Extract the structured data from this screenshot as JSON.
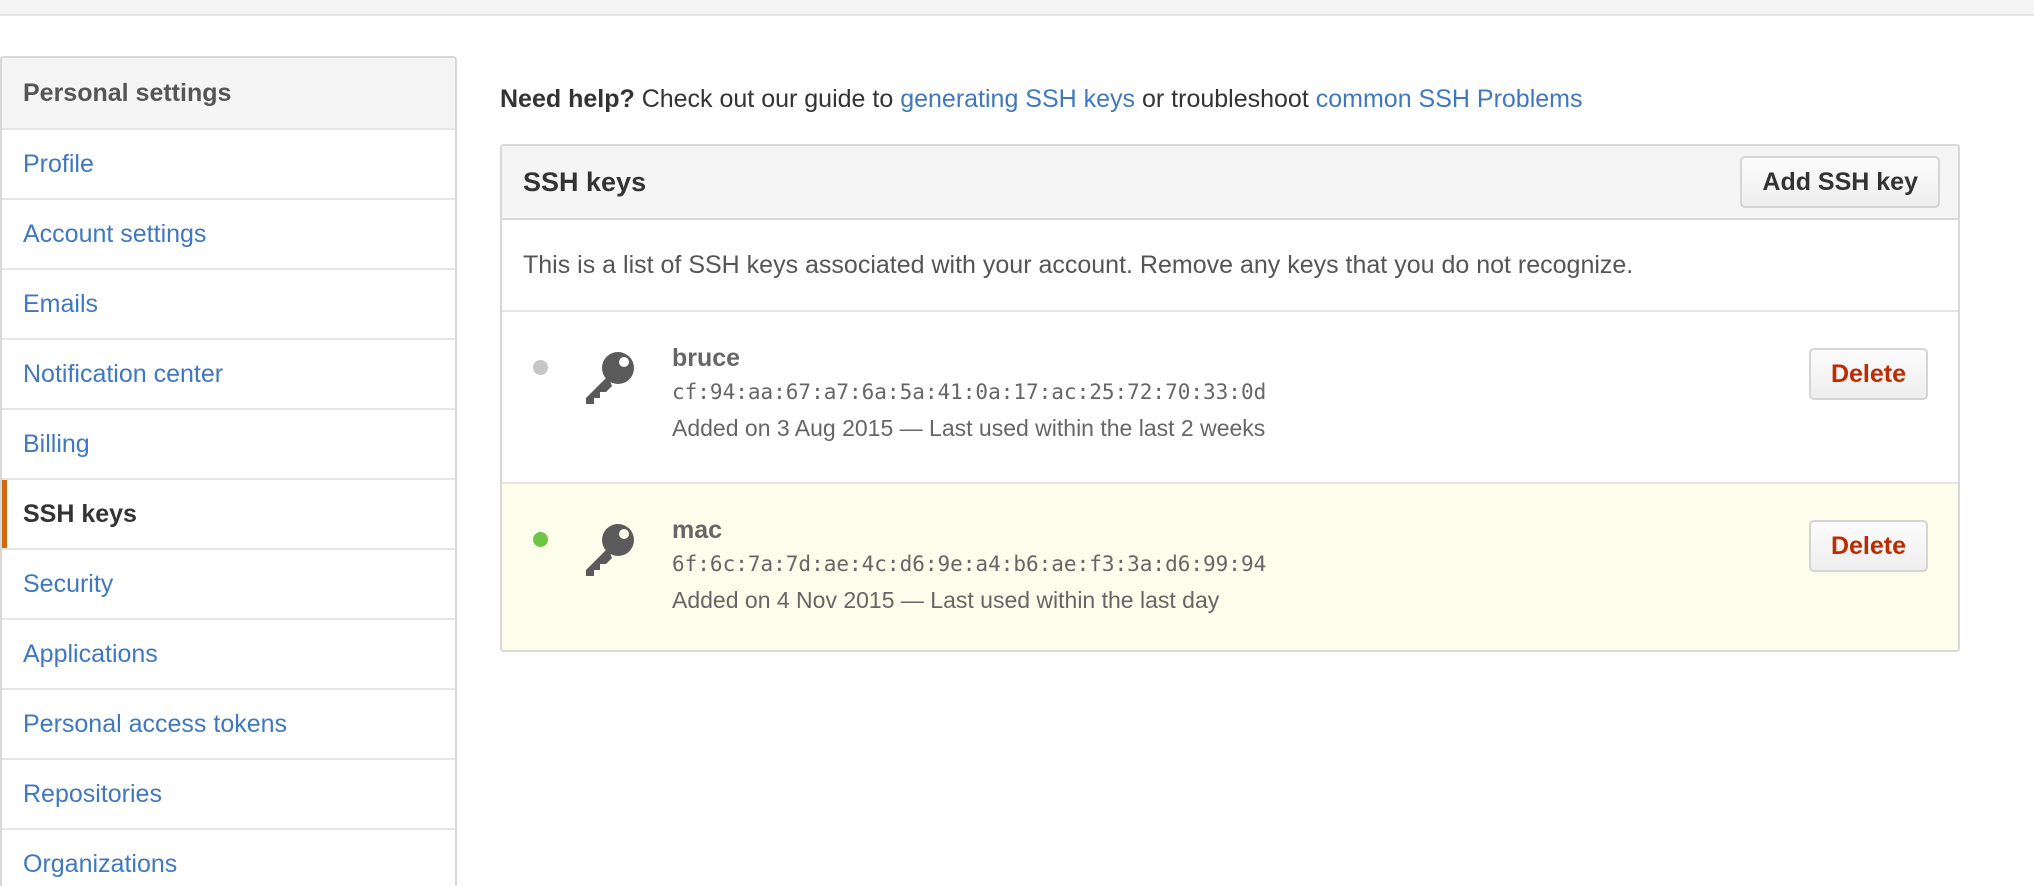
{
  "sidebar": {
    "header": "Personal settings",
    "items": [
      {
        "label": "Profile",
        "selected": false
      },
      {
        "label": "Account settings",
        "selected": false
      },
      {
        "label": "Emails",
        "selected": false
      },
      {
        "label": "Notification center",
        "selected": false
      },
      {
        "label": "Billing",
        "selected": false
      },
      {
        "label": "SSH keys",
        "selected": true
      },
      {
        "label": "Security",
        "selected": false
      },
      {
        "label": "Applications",
        "selected": false
      },
      {
        "label": "Personal access tokens",
        "selected": false
      },
      {
        "label": "Repositories",
        "selected": false
      },
      {
        "label": "Organizations",
        "selected": false
      }
    ]
  },
  "help": {
    "prefix_bold": "Need help?",
    "text1": " Check out our guide to ",
    "link1": "generating SSH keys",
    "text2": " or troubleshoot ",
    "link2": "common SSH Problems"
  },
  "ssh_box": {
    "title": "SSH keys",
    "add_button": "Add SSH key",
    "description": "This is a list of SSH keys associated with your account. Remove any keys that you do not recognize.",
    "keys": [
      {
        "title": "bruce",
        "fingerprint": "cf:94:aa:67:a7:6a:5a:41:0a:17:ac:25:72:70:33:0d",
        "meta": "Added on 3 Aug 2015 — Last used within the last 2 weeks",
        "delete_label": "Delete",
        "status_color": "#c6c6c6"
      },
      {
        "title": "mac",
        "fingerprint": "6f:6c:7a:7d:ae:4c:d6:9e:a4:b6:ae:f3:3a:d6:99:94",
        "meta": "Added on 4 Nov 2015 — Last used within the last day",
        "delete_label": "Delete",
        "status_color": "#6cc644"
      }
    ]
  },
  "colors": {
    "link": "#4078c0",
    "selected_accent": "#d26911",
    "danger": "#bd2c00",
    "recent_bg": "#fdfdeb"
  },
  "icons": {
    "key": "key-icon",
    "status": "status-dot-icon"
  }
}
